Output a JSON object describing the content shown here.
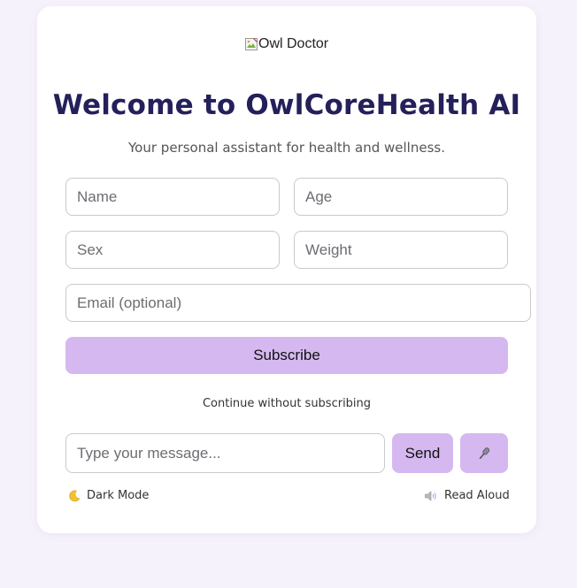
{
  "header": {
    "logo_alt": "Owl Doctor",
    "title": "Welcome to OwlCoreHealth AI",
    "subtitle": "Your personal assistant for health and wellness."
  },
  "form": {
    "name_placeholder": "Name",
    "age_placeholder": "Age",
    "sex_placeholder": "Sex",
    "weight_placeholder": "Weight",
    "email_placeholder": "Email (optional)",
    "subscribe_label": "Subscribe",
    "skip_label": "Continue without subscribing"
  },
  "chat": {
    "message_placeholder": "Type your message...",
    "send_label": "Send",
    "mic_icon": "microphone-icon"
  },
  "footer": {
    "dark_mode_label": "Dark Mode",
    "dark_mode_icon": "crescent-moon-icon",
    "read_aloud_label": "Read Aloud",
    "read_aloud_icon": "speaker-icon"
  },
  "colors": {
    "accent": "#d5b8f0",
    "title": "#24205a",
    "background": "#f6f2fb"
  }
}
